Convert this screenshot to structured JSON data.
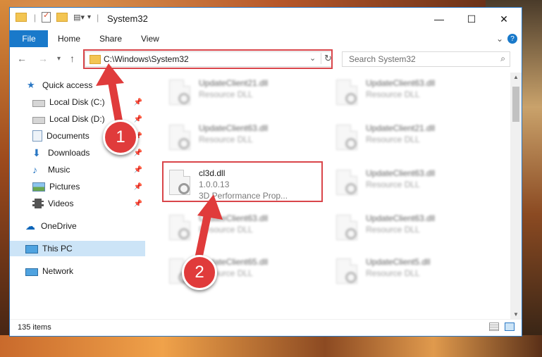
{
  "window": {
    "title": "System32",
    "controls": {
      "minimize": "—",
      "maximize": "☐",
      "close": "✕"
    }
  },
  "ribbon": {
    "tabs": [
      "File",
      "Home",
      "Share",
      "View"
    ],
    "collapse_icon": "chevron-down-icon",
    "help_icon": "?"
  },
  "address": {
    "path": "C:\\Windows\\System32",
    "search_placeholder": "Search System32"
  },
  "nav": {
    "items": [
      {
        "label": "Quick access",
        "icon": "star-icon"
      },
      {
        "label": "Local Disk (C:)",
        "icon": "drive-icon"
      },
      {
        "label": "Local Disk (D:)",
        "icon": "drive-icon"
      },
      {
        "label": "Documents",
        "icon": "documents-icon"
      },
      {
        "label": "Downloads",
        "icon": "downloads-icon"
      },
      {
        "label": "Music",
        "icon": "music-icon"
      },
      {
        "label": "Pictures",
        "icon": "pictures-icon"
      },
      {
        "label": "Videos",
        "icon": "videos-icon"
      },
      {
        "label": "OneDrive",
        "icon": "cloud-icon"
      },
      {
        "label": "This PC",
        "icon": "computer-icon"
      },
      {
        "label": "Network",
        "icon": "network-icon"
      }
    ]
  },
  "files": {
    "left": [
      {
        "name": "UpdateClient21.dll",
        "sub": "Resource DLL"
      },
      {
        "name": "UpdateClient63.dll",
        "sub": "Resource DLL"
      },
      {
        "name": "cl3d.dll",
        "version": "1.0.0.13",
        "sub": "3D Performance Prop..."
      },
      {
        "name": "UpdateClient63.dll",
        "sub": "Resource DLL"
      },
      {
        "name": "UpdateClient65.dll",
        "sub": "Resource DLL"
      }
    ],
    "right": [
      {
        "name": "UpdateClient63.dll",
        "sub": "Resource DLL"
      },
      {
        "name": "UpdateClient21.dll",
        "sub": "Resource DLL"
      },
      {
        "name": "UpdateClient63.dll",
        "sub": "Resource DLL"
      },
      {
        "name": "UpdateClient63.dll",
        "sub": "Resource DLL"
      },
      {
        "name": "UpdateClient5.dll",
        "sub": "Resource DLL"
      }
    ]
  },
  "status": {
    "count": "135 items"
  },
  "annotations": {
    "step1": "1",
    "step2": "2",
    "color": "#e03b3b"
  }
}
